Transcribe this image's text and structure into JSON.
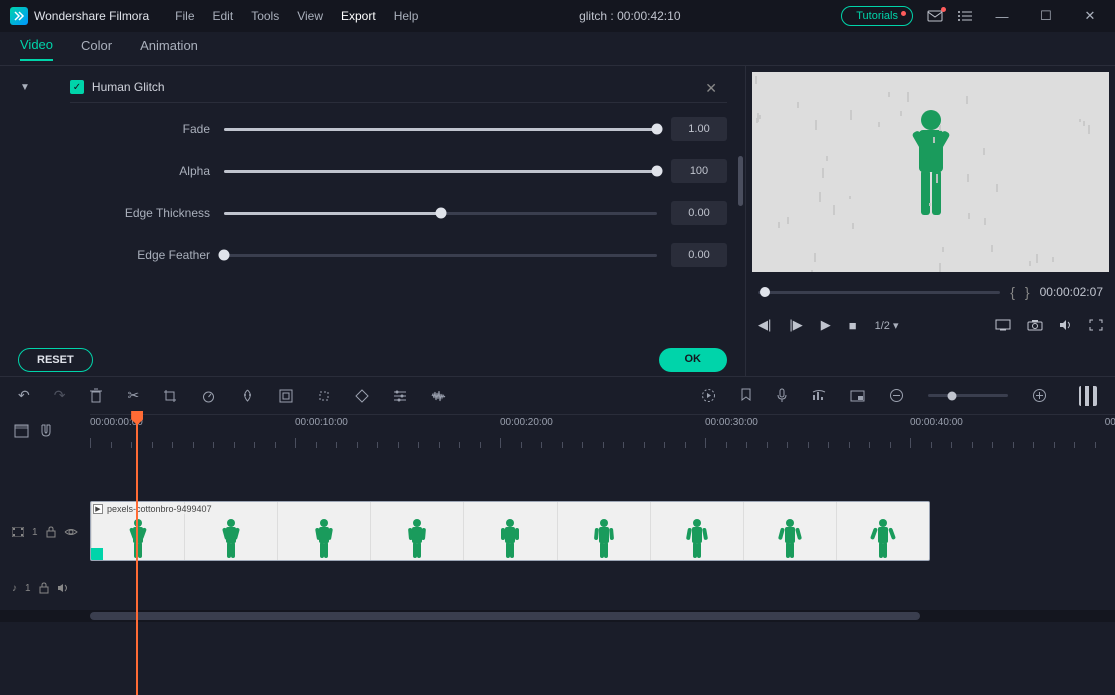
{
  "app": {
    "name": "Wondershare Filmora"
  },
  "menu": {
    "file": "File",
    "edit": "Edit",
    "tools": "Tools",
    "view": "View",
    "export": "Export",
    "help": "Help"
  },
  "project": {
    "title": "glitch : 00:00:42:10"
  },
  "titlebar": {
    "tutorials": "Tutorials"
  },
  "tabs": {
    "video": "Video",
    "color": "Color",
    "animation": "Animation"
  },
  "effect": {
    "name": "Human Glitch",
    "params": [
      {
        "label": "Fade",
        "value": "1.00",
        "pct": 100
      },
      {
        "label": "Alpha",
        "value": "100",
        "pct": 100
      },
      {
        "label": "Edge Thickness",
        "value": "0.00",
        "pct": 50
      },
      {
        "label": "Edge Feather",
        "value": "0.00",
        "pct": 0
      }
    ]
  },
  "buttons": {
    "reset": "RESET",
    "ok": "OK"
  },
  "preview": {
    "timecode": "00:00:02:07",
    "zoom": "1/2"
  },
  "timeline": {
    "labels": [
      "00:00:00:00",
      "00:00:10:00",
      "00:00:20:00",
      "00:00:30:00",
      "00:00:40:00",
      "00:"
    ],
    "clip_name": "pexels-cottonbro-9499407",
    "playhead_pct": 4.5,
    "track_video": "1",
    "track_audio": "1"
  }
}
